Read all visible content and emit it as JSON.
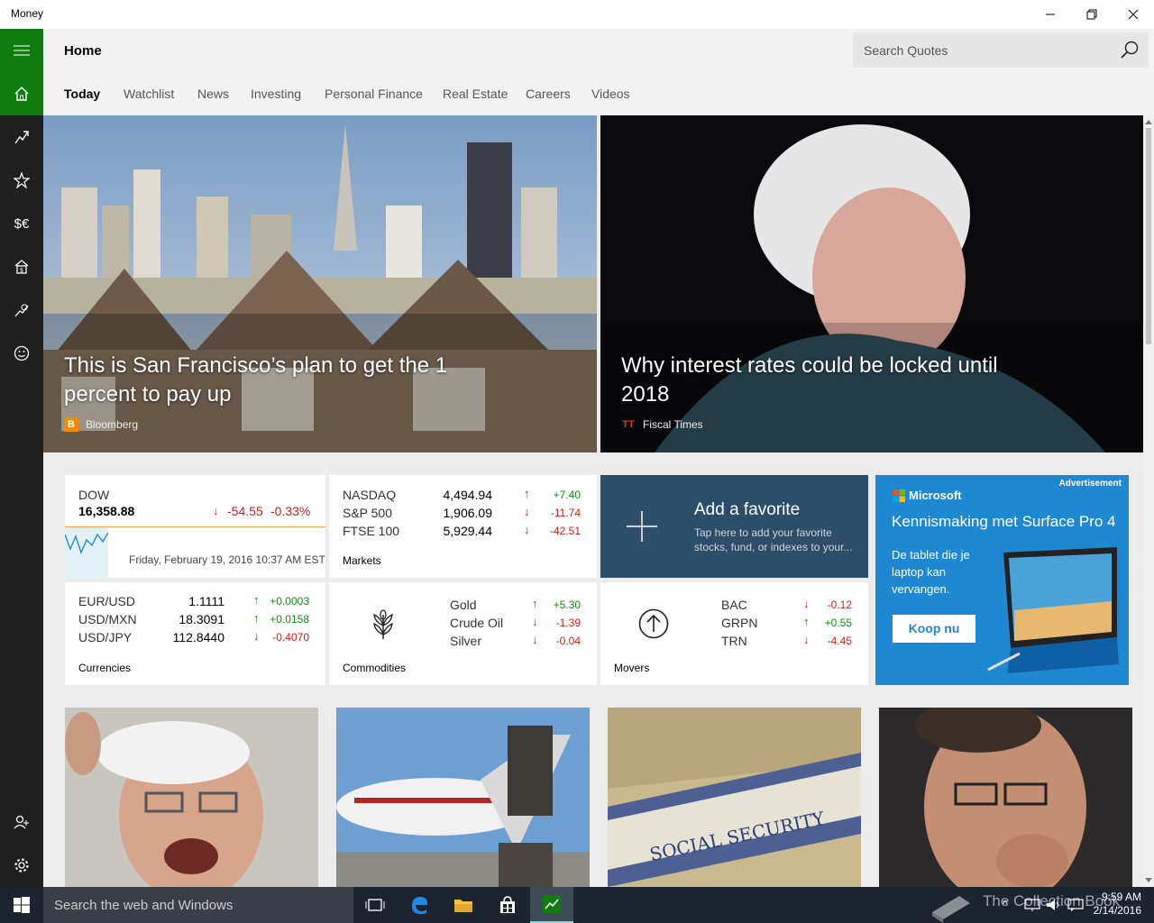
{
  "window": {
    "title": "Money"
  },
  "header": {
    "page_title": "Home",
    "search_placeholder": "Search Quotes",
    "tabs": [
      {
        "label": "Today"
      },
      {
        "label": "Watchlist"
      },
      {
        "label": "News"
      },
      {
        "label": "Investing"
      },
      {
        "label": "Personal Finance"
      },
      {
        "label": "Real Estate"
      },
      {
        "label": "Careers"
      },
      {
        "label": "Videos"
      }
    ]
  },
  "sidebar": {
    "items": [
      {
        "icon": "hamburger-menu-icon"
      },
      {
        "icon": "home-icon"
      },
      {
        "icon": "trend-chart-icon"
      },
      {
        "icon": "star-list-icon"
      },
      {
        "icon": "currency-icon"
      },
      {
        "icon": "mortgage-house-icon"
      },
      {
        "icon": "retirement-icon"
      },
      {
        "icon": "smiley-icon"
      },
      {
        "icon": "add-account-icon"
      },
      {
        "icon": "settings-gear-icon"
      }
    ],
    "currency_glyph": "$€"
  },
  "heroes": [
    {
      "headline": "This is San Francisco’s plan to get the 1 percent to pay up",
      "source": "Bloomberg",
      "source_logo": "B"
    },
    {
      "headline": "Why interest rates could be locked until 2018",
      "source": "Fiscal Times",
      "source_logo": "TT"
    }
  ],
  "dow": {
    "name": "DOW",
    "value": "16,358.88",
    "change": "-54.55",
    "percent": "-0.33%",
    "timestamp": "Friday, February 19, 2016 10:37 AM EST"
  },
  "markets": {
    "label": "Markets",
    "rows": [
      {
        "name": "NASDAQ",
        "value": "4,494.94",
        "change": "+7.40",
        "dir": "up"
      },
      {
        "name": "S&P 500",
        "value": "1,906.09",
        "change": "-11.74",
        "dir": "down"
      },
      {
        "name": "FTSE 100",
        "value": "5,929.44",
        "change": "-42.51",
        "dir": "down"
      }
    ]
  },
  "favorite": {
    "title": "Add a favorite",
    "desc": "Tap here to add your favorite stocks, fund, or indexes to your..."
  },
  "ad": {
    "badge": "Advertisement",
    "brand": "Microsoft",
    "title": "Kennismaking met Surface Pro 4",
    "body": "De tablet die je laptop kan vervangen.",
    "cta": "Koop nu"
  },
  "currencies": {
    "label": "Currencies",
    "rows": [
      {
        "name": "EUR/USD",
        "value": "1.1111",
        "change": "+0.0003",
        "dir": "up"
      },
      {
        "name": "USD/MXN",
        "value": "18.3091",
        "change": "+0.0158",
        "dir": "up"
      },
      {
        "name": "USD/JPY",
        "value": "112.8440",
        "change": "-0.4070",
        "dir": "down"
      }
    ]
  },
  "commodities": {
    "label": "Commodities",
    "rows": [
      {
        "name": "Gold",
        "change": "+5.30",
        "dir": "up"
      },
      {
        "name": "Crude Oil",
        "change": "-1.39",
        "dir": "down"
      },
      {
        "name": "Silver",
        "change": "-0.04",
        "dir": "down"
      }
    ]
  },
  "movers": {
    "label": "Movers",
    "rows": [
      {
        "name": "BAC",
        "change": "-0.12",
        "dir": "down"
      },
      {
        "name": "GRPN",
        "change": "+0.55",
        "dir": "up"
      },
      {
        "name": "TRN",
        "change": "-4.45",
        "dir": "down"
      }
    ]
  },
  "taskbar": {
    "search_placeholder": "Search the web and Windows",
    "time": "9:59 AM",
    "date": "2/14/2016",
    "watermark": "The Collection Book"
  },
  "colors": {
    "accent": "#107c10",
    "favorite_tile": "#2d4e69",
    "ad_bg": "#1e88d2",
    "up": "#148a14",
    "down": "#d31a1a"
  }
}
